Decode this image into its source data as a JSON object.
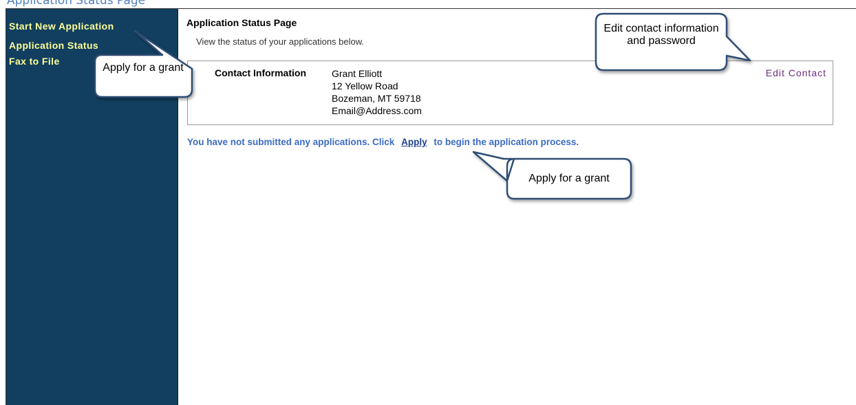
{
  "document": {
    "heading": "Application Status Page"
  },
  "sidebar": {
    "items": [
      {
        "label": "Start New Application"
      },
      {
        "label": "Application Status"
      },
      {
        "label": "Fax to File"
      }
    ]
  },
  "main": {
    "title": "Application Status Page",
    "subtitle": "View the status of your applications below.",
    "contact": {
      "label": "Contact Information",
      "name": "Grant Elliott",
      "address1": "12 Yellow Road",
      "address2": "Bozeman, MT 59718",
      "email": "Email@Address.com",
      "edit_label": "Edit Contact"
    },
    "notice": {
      "before": "You have not submitted any applications. Click",
      "link": "Apply",
      "after": "to begin the application process."
    }
  },
  "callouts": {
    "sidebar_apply": "Apply for a grant",
    "edit_contact": "Edit contact information and password",
    "apply_link": "Apply for a grant"
  },
  "colors": {
    "sidebar_bg": "#123f5f",
    "sidebar_text": "#ffff99",
    "notice_text": "#3c6bc4",
    "edit_link": "#6b2c7e",
    "doc_heading": "#4f81bd"
  }
}
